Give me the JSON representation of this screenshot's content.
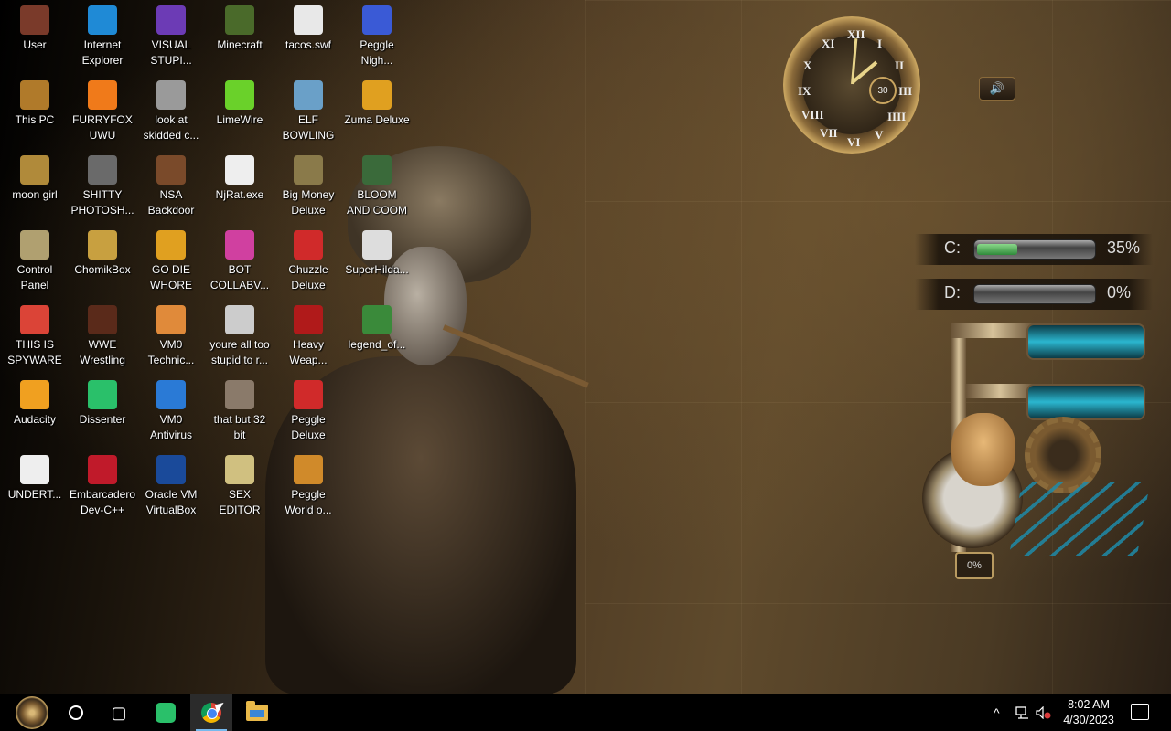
{
  "desktop": {
    "icons": [
      {
        "label": "User",
        "glyph": "user-folder-icon",
        "color": "#7a3a2a",
        "col": 0,
        "row": 0
      },
      {
        "label": "Internet\nExplorer",
        "glyph": "edge-icon",
        "color": "#1f8ad6",
        "col": 1,
        "row": 0
      },
      {
        "label": "VISUAL\nSTUPI...",
        "glyph": "visual-studio-icon",
        "color": "#6c3bb5",
        "col": 2,
        "row": 0
      },
      {
        "label": "Minecraft",
        "glyph": "minecraft-icon",
        "color": "#4a6a2a",
        "col": 3,
        "row": 0
      },
      {
        "label": "tacos.swf",
        "glyph": "swf-file-icon",
        "color": "#e8e8e8",
        "col": 4,
        "row": 0
      },
      {
        "label": "Peggle\nNigh...",
        "glyph": "peggle-icon",
        "color": "#3a5ad6",
        "col": 5,
        "row": 0
      },
      {
        "label": "This PC",
        "glyph": "this-pc-icon",
        "color": "#b07a2a",
        "col": 0,
        "row": 1
      },
      {
        "label": "FURRYFOX\nUWU",
        "glyph": "firefox-icon",
        "color": "#f07a1a",
        "col": 1,
        "row": 1
      },
      {
        "label": "look at\nskidded c...",
        "glyph": "copy-files-icon",
        "color": "#9a9a9a",
        "col": 2,
        "row": 1
      },
      {
        "label": "LimeWire",
        "glyph": "limewire-icon",
        "color": "#6ad12a",
        "col": 3,
        "row": 1
      },
      {
        "label": "ELF\nBOWLING",
        "glyph": "elf-bowling-icon",
        "color": "#6aa0c8",
        "col": 4,
        "row": 1
      },
      {
        "label": "Zuma Deluxe",
        "glyph": "zuma-icon",
        "color": "#e0a020",
        "col": 5,
        "row": 1
      },
      {
        "label": "moon girl",
        "glyph": "folder-icon",
        "color": "#b08a3a",
        "col": 0,
        "row": 2
      },
      {
        "label": "SHITTY\nPHOTOSH...",
        "glyph": "gimp-icon",
        "color": "#6a6a6a",
        "col": 1,
        "row": 2
      },
      {
        "label": "NSA\nBackdoor",
        "glyph": "image-file-icon",
        "color": "#7a4a2a",
        "col": 2,
        "row": 2
      },
      {
        "label": "NjRat.exe",
        "glyph": "skull-icon",
        "color": "#eeeeee",
        "col": 3,
        "row": 2
      },
      {
        "label": "Big Money\nDeluxe",
        "glyph": "money-bag-icon",
        "color": "#8a7a4a",
        "col": 4,
        "row": 2
      },
      {
        "label": "BLOOM\nAND COOM",
        "glyph": "flower-icon",
        "color": "#3a6a3a",
        "col": 5,
        "row": 2
      },
      {
        "label": "Control\nPanel",
        "glyph": "control-panel-icon",
        "color": "#b0a070",
        "col": 0,
        "row": 3
      },
      {
        "label": "ChomikBox",
        "glyph": "chomikbox-icon",
        "color": "#c8a040",
        "col": 1,
        "row": 3
      },
      {
        "label": "GO DIE\nWHORE",
        "glyph": "de-app-icon",
        "color": "#e0a020",
        "col": 2,
        "row": 3
      },
      {
        "label": "BOT\nCOLLABV...",
        "glyph": "cards-icon",
        "color": "#d040a0",
        "col": 3,
        "row": 3
      },
      {
        "label": "Chuzzle\nDeluxe",
        "glyph": "chuzzle-icon",
        "color": "#d02a2a",
        "col": 4,
        "row": 3
      },
      {
        "label": "SuperHilda...",
        "glyph": "pixel-art-icon",
        "color": "#dddddd",
        "col": 5,
        "row": 3
      },
      {
        "label": "THIS IS\nSPYWARE",
        "glyph": "chrome-icon",
        "color": "#db4437",
        "col": 0,
        "row": 4
      },
      {
        "label": "WWE\nWrestling",
        "glyph": "wwe-icon",
        "color": "#5a2a1a",
        "col": 1,
        "row": 4
      },
      {
        "label": "VM0\nTechnic...",
        "glyph": "technician-icon",
        "color": "#e08a3a",
        "col": 2,
        "row": 4
      },
      {
        "label": "youre all too\nstupid to r...",
        "glyph": "portrait-icon",
        "color": "#cccccc",
        "col": 3,
        "row": 4
      },
      {
        "label": "Heavy\nWeap...",
        "glyph": "radiation-icon",
        "color": "#b01a1a",
        "col": 4,
        "row": 4
      },
      {
        "label": "legend_of...",
        "glyph": "sprite-icon",
        "color": "#3a8a3a",
        "col": 5,
        "row": 4
      },
      {
        "label": "Audacity",
        "glyph": "audacity-icon",
        "color": "#f0a020",
        "col": 0,
        "row": 5
      },
      {
        "label": "Dissenter",
        "glyph": "dissenter-icon",
        "color": "#2ac06a",
        "col": 1,
        "row": 5
      },
      {
        "label": "VM0\nAntivirus",
        "glyph": "shield-icon",
        "color": "#2a7ad6",
        "col": 2,
        "row": 5
      },
      {
        "label": "that but 32\nbit",
        "glyph": "portrait-icon",
        "color": "#8a7a6a",
        "col": 3,
        "row": 5
      },
      {
        "label": "Peggle\nDeluxe",
        "glyph": "peggle-icon",
        "color": "#d02a2a",
        "col": 4,
        "row": 5
      },
      {
        "label": "UNDERT...",
        "glyph": "unity-icon",
        "color": "#eeeeee",
        "col": 0,
        "row": 6
      },
      {
        "label": "Embarcadero\nDev-C++",
        "glyph": "dev-cpp-icon",
        "color": "#c01a2a",
        "col": 1,
        "row": 6
      },
      {
        "label": "Oracle VM\nVirtualBox",
        "glyph": "virtualbox-icon",
        "color": "#1a4a9a",
        "col": 2,
        "row": 6
      },
      {
        "label": "SEX\nEDITOR",
        "glyph": "xd-editor-icon",
        "color": "#d0c080",
        "col": 3,
        "row": 6
      },
      {
        "label": "Peggle\nWorld o...",
        "glyph": "peggle-icon",
        "color": "#d08a2a",
        "col": 4,
        "row": 6
      }
    ]
  },
  "widgets": {
    "clock": {
      "numerals": [
        "XII",
        "I",
        "II",
        "III",
        "IIII",
        "V",
        "VI",
        "VII",
        "VIII",
        "IX",
        "X",
        "XI"
      ],
      "sub_dial": "30"
    },
    "speaker": {
      "glyph": "speaker-icon"
    },
    "drives": [
      {
        "letter": "C:",
        "percent_text": "35%",
        "used_fraction": 0.35
      },
      {
        "letter": "D:",
        "percent_text": "0%",
        "used_fraction": 0.0
      }
    ],
    "pipes": {
      "meter_text": "0%"
    }
  },
  "taskbar": {
    "start": "start-orb-icon",
    "pinned": [
      {
        "name": "dissenter",
        "active": false,
        "running": false
      },
      {
        "name": "chrome",
        "active": true,
        "running": true
      },
      {
        "name": "file-explorer",
        "active": false,
        "running": false
      }
    ],
    "tray": {
      "chevron": "^",
      "time": "8:02 AM",
      "date": "4/30/2023"
    }
  },
  "colors": {
    "taskbar_bg": "#000000",
    "active_underline": "#76b9ed",
    "drive_fill": "#2f8a3a",
    "tank_blue": "#2bb6cf"
  }
}
